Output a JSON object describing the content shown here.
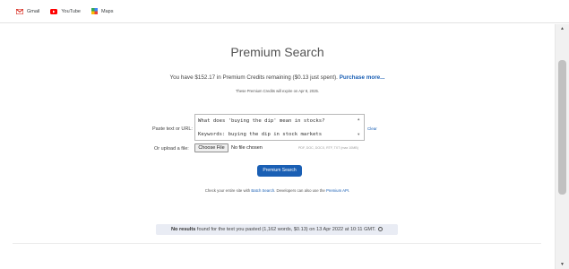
{
  "bookmarks": [
    {
      "label": "Gmail",
      "icon": "gmail-icon"
    },
    {
      "label": "YouTube",
      "icon": "youtube-icon"
    },
    {
      "label": "Maps",
      "icon": "maps-icon"
    }
  ],
  "main": {
    "title": "Premium Search",
    "credits": {
      "text": "You have $152.17 in Premium Credits remaining ($0.13 just spent).",
      "purchase_label": "Purchase more..."
    },
    "expire_text": "These Premium Credits will expire on Apr 8, 2025."
  },
  "form": {
    "paste_label": "Paste text or URL:",
    "textarea_line1": "What does 'buying the dip' mean in stocks?",
    "textarea_line2": "Keywords: buying the dip in stock markets",
    "clear_label": "Clear",
    "upload_label": "Or upload a file:",
    "choose_file_label": "Choose File",
    "no_file_text": "No file chosen",
    "file_types": "PDF, DOC, DOCX, RTF, TXT (max 10MB)",
    "search_button_label": "Premium Search"
  },
  "note": {
    "prefix": "Check your entire site with",
    "batch_link": "Batch Search",
    "middle": ". Developers can also use the",
    "api_link": "Premium API",
    "suffix": "."
  },
  "results": {
    "bold": "No results",
    "text": "found for the text you pasted (1,162 words, $0.13) on 13 Apr 2022 at 10:11 GMT."
  },
  "colors": {
    "accent": "#1a5fb4",
    "results_bg": "#e9ecf4"
  }
}
